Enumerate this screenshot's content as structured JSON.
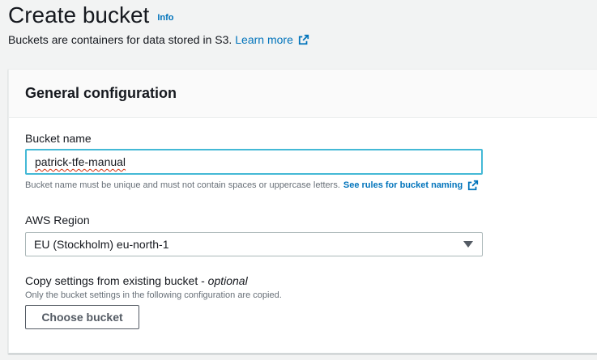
{
  "header": {
    "title": "Create bucket",
    "info_label": "Info",
    "subtitle": "Buckets are containers for data stored in S3.",
    "learn_more": "Learn more"
  },
  "general": {
    "title": "General configuration",
    "bucket_name": {
      "label": "Bucket name",
      "value": "patrick-tfe-manual",
      "hint": "Bucket name must be unique and must not contain spaces or uppercase letters.",
      "rules_link": "See rules for bucket naming"
    },
    "region": {
      "label": "AWS Region",
      "selected": "EU (Stockholm) eu-north-1"
    },
    "copy_settings": {
      "label": "Copy settings from existing bucket - ",
      "optional": "optional",
      "description": "Only the bucket settings in the following configuration are copied.",
      "button": "Choose bucket"
    }
  },
  "icons": {
    "external_link": "external-link-icon",
    "dropdown": "caret-down-icon"
  },
  "colors": {
    "link": "#0073bb",
    "focus_border": "#44b9d6",
    "background": "#f2f3f3"
  }
}
